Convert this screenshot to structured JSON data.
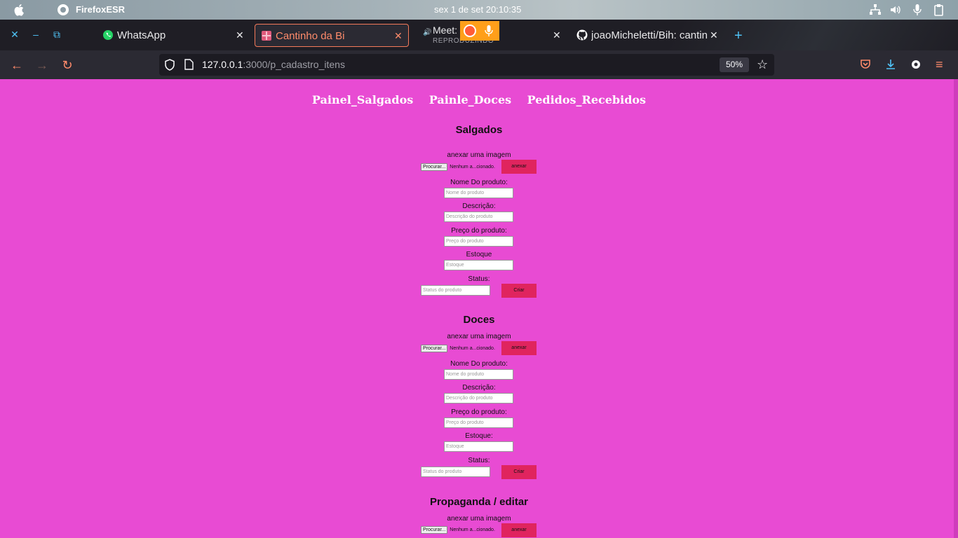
{
  "system": {
    "app_name": "FirefoxESR",
    "clock": "sex 1 de set  20:10:35"
  },
  "tabs": [
    {
      "title": "WhatsApp"
    },
    {
      "title": "Cantinho da Bi"
    },
    {
      "title": "Meet: k-qvz",
      "subtitle": "REPRODUZINDO"
    },
    {
      "title": "joaoMicheletti/Bih: cantin"
    }
  ],
  "url": {
    "host": "127.0.0.1",
    "rest": ":3000/p_cadastro_itens",
    "zoom": "50%"
  },
  "nav": [
    "Painel_Salgados",
    "Painle_Doces",
    "Pedidos_Recebidos"
  ],
  "salgados": {
    "title": "Salgados",
    "attach_label": "anexar uma imagem",
    "browse": "Procurar...",
    "no_file": "Nenhum a...cionado.",
    "attach_btn": "anexar",
    "name_label": "Nome Do produto:",
    "name_ph": "Nome do produto",
    "desc_label": "Descrição:",
    "desc_ph": "Descrição do produto",
    "price_label": "Preço do produto:",
    "price_ph": "Preço do produto",
    "stock_label": "Estoque",
    "stock_ph": "Estoque",
    "status_label": "Status:",
    "status_ph": "Status do produto",
    "create_btn": "Criar"
  },
  "doces": {
    "title": "Doces",
    "attach_label": "anexar uma imagem",
    "browse": "Procurar...",
    "no_file": "Nenhum a...cionado.",
    "attach_btn": "anexar",
    "name_label": "Nome Do produto:",
    "name_ph": "Nome do produto",
    "desc_label": "Descrição:",
    "desc_ph": "Descrição do produto",
    "price_label": "Preço do produto:",
    "price_ph": "Preço do produto",
    "stock_label": "Estoque:",
    "stock_ph": "Estoque",
    "status_label": "Status:",
    "status_ph": "Status do produto",
    "create_btn": "Criar"
  },
  "propaganda": {
    "title": "Propaganda / editar",
    "attach_label": "anexar uma imagem",
    "browse": "Procurar...",
    "no_file": "Nenhum a...cionado.",
    "attach_btn": "anexar"
  }
}
